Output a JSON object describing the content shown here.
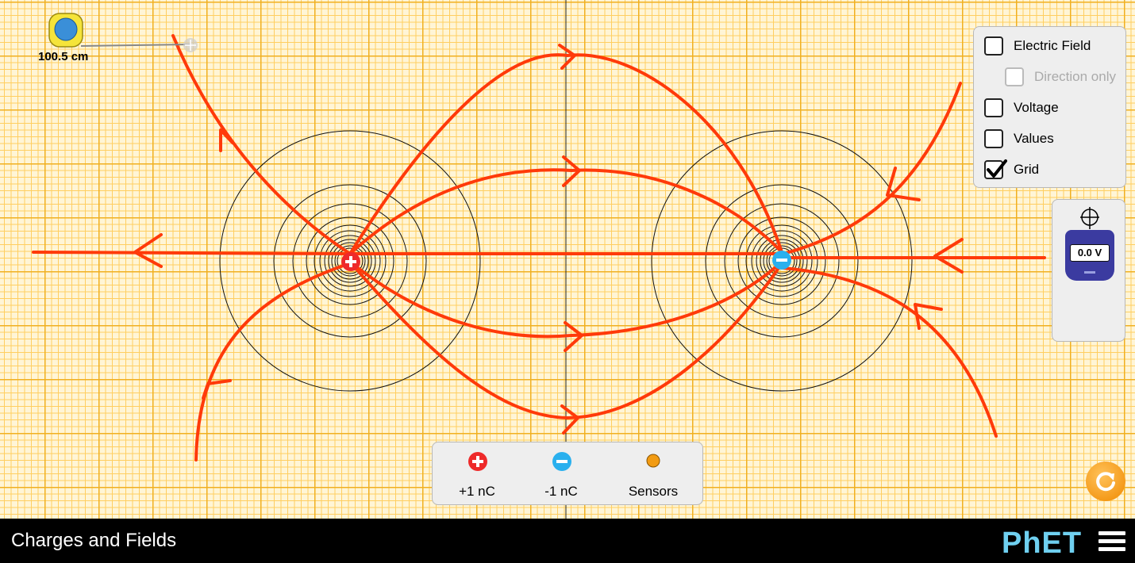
{
  "app": {
    "title": "Charges and Fields",
    "logo": "PhET"
  },
  "tape_measure": {
    "reading": "100.5 cm"
  },
  "options": [
    {
      "label": "Electric Field",
      "checked": false,
      "enabled": true
    },
    {
      "label": "Direction only",
      "checked": false,
      "enabled": false
    },
    {
      "label": "Voltage",
      "checked": false,
      "enabled": true
    },
    {
      "label": "Values",
      "checked": false,
      "enabled": true
    },
    {
      "label": "Grid",
      "checked": true,
      "enabled": true
    }
  ],
  "voltmeter": {
    "reading": "0.0 V",
    "icon": "crosshair-icon"
  },
  "toolbox": {
    "positive_label": "+1 nC",
    "negative_label": "-1 nC",
    "sensors_label": "Sensors"
  },
  "colors": {
    "field_line": "#ff3a0a",
    "positive_charge": "#ee2a2a",
    "negative_charge": "#2ab0ee",
    "sensor": "#f29b12",
    "grid_major": "#f0b020",
    "grid_minor": "#ffce60"
  }
}
